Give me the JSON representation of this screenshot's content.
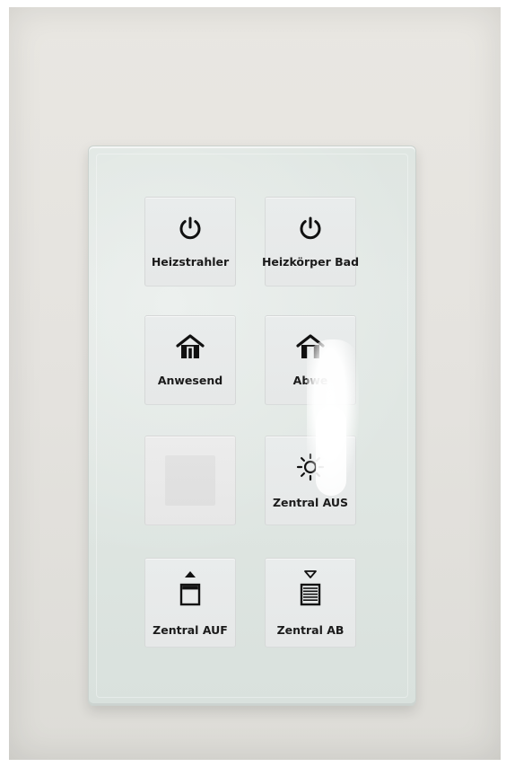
{
  "device": {
    "buttons": [
      {
        "label": "Heizstrahler",
        "icon": "power-icon"
      },
      {
        "label": "Heizkörper Bad",
        "icon": "power-icon"
      },
      {
        "label": "Anwesend",
        "icon": "home-present-icon"
      },
      {
        "label": "Abwe",
        "icon": "home-away-icon"
      },
      {
        "label": "",
        "icon": "blank-icon"
      },
      {
        "label": "Zentral AUS",
        "icon": "sun-icon"
      },
      {
        "label": "Zentral AUF",
        "icon": "blind-up-icon"
      },
      {
        "label": "Zentral AB",
        "icon": "blind-down-icon"
      }
    ],
    "colors": {
      "panel": "#dfe6e2",
      "tile": "#e8ebeb",
      "ink": "#1b1b1b"
    }
  }
}
